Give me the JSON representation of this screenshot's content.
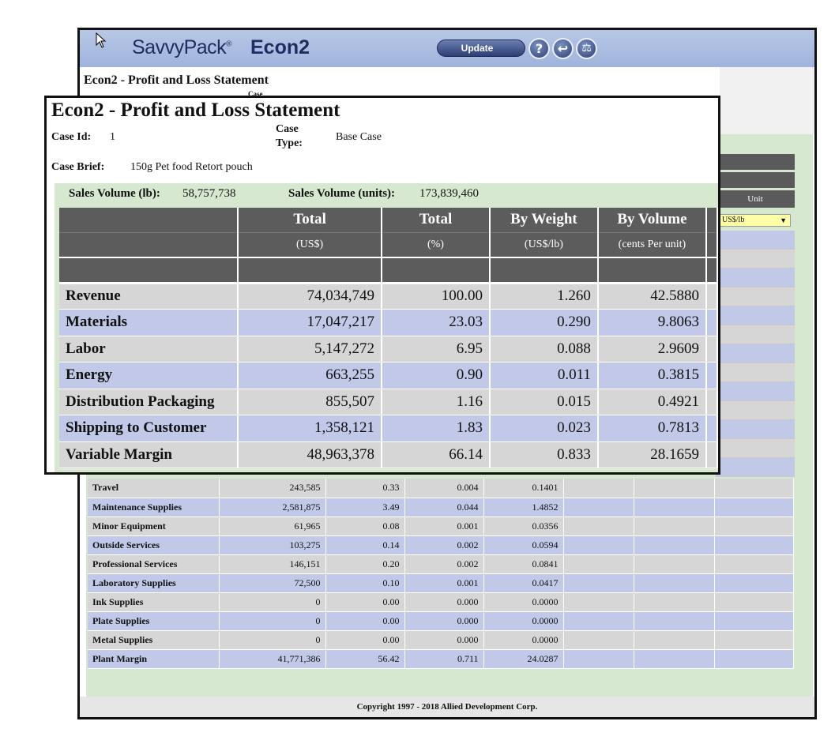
{
  "app": {
    "brand": "SavvyPack",
    "brand_mark": "®",
    "module": "Econ2",
    "update_label": "Update",
    "help_glyph": "?",
    "back_glyph": "↩",
    "balance_glyph": "⚖",
    "page_title": "Econ2 - Profit and Loss Statement",
    "case_tiny": "Case",
    "unit_header": "Unit",
    "unit_selected": "US$/lb",
    "copyright": "Copyright 1997 - 2018 Allied Development Corp."
  },
  "popup": {
    "title": "Econ2 - Profit and Loss Statement",
    "case_id_label": "Case Id:",
    "case_id": "1",
    "case_type_label": "Case Type:",
    "case_type": "Base Case",
    "case_brief_label": "Case Brief:",
    "case_brief": "150g Pet food Retort pouch",
    "sales_volume_lb_label": "Sales Volume (lb):",
    "sales_volume_lb": "58,757,738",
    "sales_volume_units_label": "Sales Volume (units):",
    "sales_volume_units": "173,839,460",
    "headers": [
      {
        "title": "Total",
        "unit": "(US$)"
      },
      {
        "title": "Total",
        "unit": "(%)"
      },
      {
        "title": "By Weight",
        "unit": "(US$/lb)"
      },
      {
        "title": "By Volume",
        "unit": "(cents Per unit)"
      }
    ],
    "rows": [
      {
        "label": "Revenue",
        "total": "74,034,749",
        "pct": "100.00",
        "weight": "1.260",
        "volume": "42.5880"
      },
      {
        "label": "Materials",
        "total": "17,047,217",
        "pct": "23.03",
        "weight": "0.290",
        "volume": "9.8063"
      },
      {
        "label": "Labor",
        "total": "5,147,272",
        "pct": "6.95",
        "weight": "0.088",
        "volume": "2.9609"
      },
      {
        "label": "Energy",
        "total": "663,255",
        "pct": "0.90",
        "weight": "0.011",
        "volume": "0.3815"
      },
      {
        "label": "Distribution Packaging",
        "total": "855,507",
        "pct": "1.16",
        "weight": "0.015",
        "volume": "0.4921"
      },
      {
        "label": "Shipping to Customer",
        "total": "1,358,121",
        "pct": "1.83",
        "weight": "0.023",
        "volume": "0.7813"
      },
      {
        "label": "Variable Margin",
        "total": "48,963,378",
        "pct": "66.14",
        "weight": "0.833",
        "volume": "28.1659"
      }
    ]
  },
  "background_rows": [
    {
      "label": "Travel",
      "total": "243,585",
      "pct": "0.33",
      "weight": "0.004",
      "volume": "0.1401"
    },
    {
      "label": "Maintenance Supplies",
      "total": "2,581,875",
      "pct": "3.49",
      "weight": "0.044",
      "volume": "1.4852"
    },
    {
      "label": "Minor Equipment",
      "total": "61,965",
      "pct": "0.08",
      "weight": "0.001",
      "volume": "0.0356"
    },
    {
      "label": "Outside Services",
      "total": "103,275",
      "pct": "0.14",
      "weight": "0.002",
      "volume": "0.0594"
    },
    {
      "label": "Professional Services",
      "total": "146,151",
      "pct": "0.20",
      "weight": "0.002",
      "volume": "0.0841"
    },
    {
      "label": "Laboratory Supplies",
      "total": "72,500",
      "pct": "0.10",
      "weight": "0.001",
      "volume": "0.0417"
    },
    {
      "label": "Ink Supplies",
      "total": "0",
      "pct": "0.00",
      "weight": "0.000",
      "volume": "0.0000"
    },
    {
      "label": "Plate Supplies",
      "total": "0",
      "pct": "0.00",
      "weight": "0.000",
      "volume": "0.0000"
    },
    {
      "label": "Metal Supplies",
      "total": "0",
      "pct": "0.00",
      "weight": "0.000",
      "volume": "0.0000"
    },
    {
      "label": "Plant Margin",
      "total": "41,771,386",
      "pct": "56.42",
      "weight": "0.711",
      "volume": "24.0287"
    }
  ]
}
